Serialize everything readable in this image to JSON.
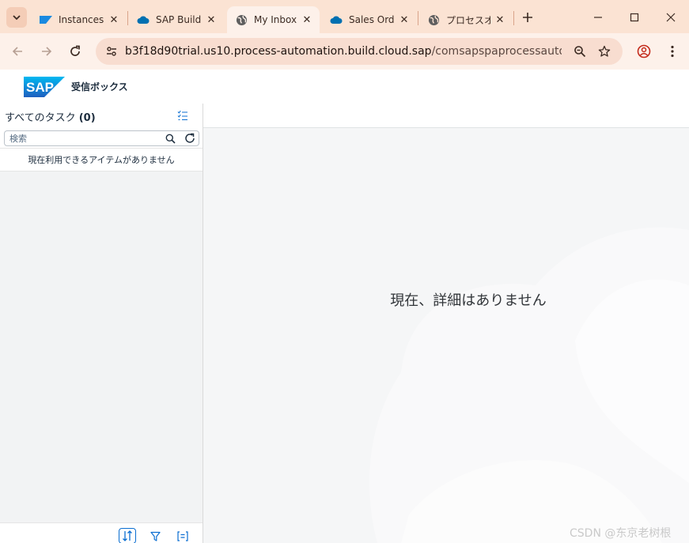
{
  "browser": {
    "tabs": [
      {
        "title": "Instances",
        "favicon": "sap-logo-icon",
        "active": false
      },
      {
        "title": "SAP Build",
        "favicon": "cloud-icon",
        "active": false
      },
      {
        "title": "My Inbox",
        "favicon": "globe-icon",
        "active": true
      },
      {
        "title": "Sales Orde",
        "favicon": "cloud-icon",
        "active": false
      },
      {
        "title": "プロセスオー",
        "favicon": "globe-icon",
        "active": false
      }
    ],
    "url_host": "b3f18d90trial.us10.process-automation.build.cloud.sap",
    "url_path": "/comsapspaprocessautomation.c...",
    "accent_color": "#fbe3d3"
  },
  "app": {
    "logo_text": "SAP",
    "title": "受信ボックス",
    "brand_color": "#0a6ed1"
  },
  "master": {
    "title": "すべてのタスク",
    "count": "(0)",
    "search_placeholder": "検索",
    "empty_message": "現在利用できるアイテムがありません"
  },
  "detail": {
    "empty_message": "現在、詳細はありません"
  },
  "watermark": "CSDN @东京老树根"
}
